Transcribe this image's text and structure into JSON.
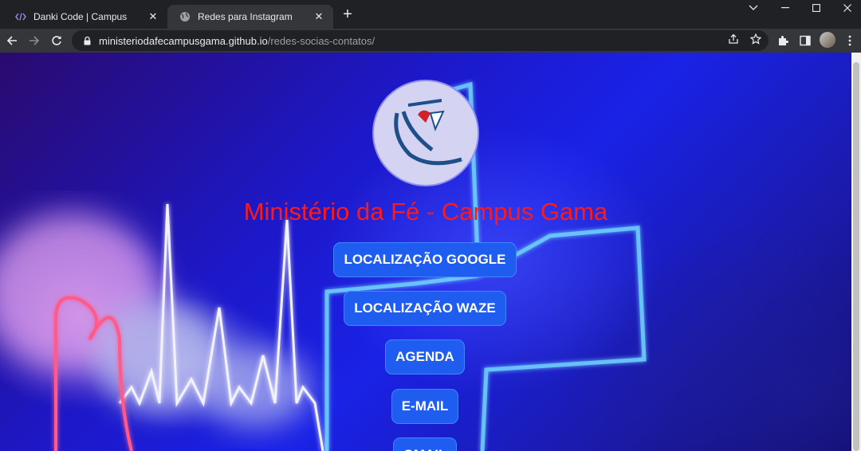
{
  "browser": {
    "tabs": [
      {
        "title": "Danki Code | Campus",
        "icon": "code-icon",
        "active": false
      },
      {
        "title": "Redes para Instagram",
        "icon": "globe-icon",
        "active": true
      }
    ],
    "url_domain": "ministeriodafecampusgama.github.io",
    "url_path": "/redes-socias-contatos/"
  },
  "page": {
    "title": "Ministério da Fé - Campus Gama",
    "buttons": [
      {
        "label": "LOCALIZAÇÃO GOOGLE"
      },
      {
        "label": "LOCALIZAÇÃO WAZE"
      },
      {
        "label": "AGENDA"
      },
      {
        "label": "E-MAIL"
      },
      {
        "label": "GMAIL"
      }
    ]
  },
  "colors": {
    "title": "#ff1a1a",
    "button": "#1f5cf0",
    "browser_frame": "#202124",
    "active_tab": "#35363a"
  }
}
